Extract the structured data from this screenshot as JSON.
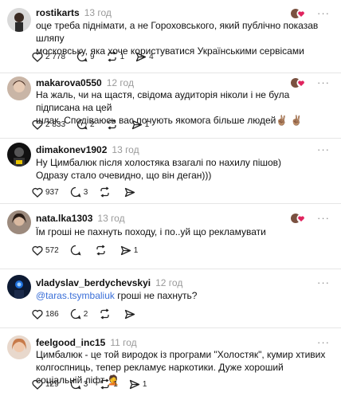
{
  "posts": [
    {
      "username": "rostikarts",
      "time": "13 год",
      "line1": "оце треба піднімати, а не Гороховського, який публічно показав шляпу",
      "line2": "московську, яка хоче користуватися Українськими сервісами",
      "likes": "2 778",
      "replies": "9",
      "reposts": "1",
      "shares": "4",
      "liked_by_author_badge": true
    },
    {
      "username": "makarova0550",
      "time": "12 год",
      "line1": "На жаль, чи на щастя, свідома аудиторія ніколи і не була підписана на цей",
      "line2": "шлак. Сподіваюсь вас почують якомога більше людей✌🏽 ✌🏽",
      "likes": "2 833",
      "replies": "2",
      "reposts": "",
      "shares": "1",
      "liked_by_author_badge": true
    },
    {
      "username": "dimakonev1902",
      "time": "13 год",
      "line1": "Ну Цимбалюк після холостяка взагалі по нахилу пішов)",
      "line2": "Одразу стало очевидно, що він деган)))",
      "likes": "937",
      "replies": "3",
      "reposts": "",
      "shares": "",
      "liked_by_author_badge": false
    },
    {
      "username": "nata.lka1303",
      "time": "13 год",
      "line1": "Їм гроші не пахнуть походу, і по..уй що рекламувати",
      "line2": "",
      "likes": "572",
      "replies": "",
      "reposts": "",
      "shares": "1",
      "liked_by_author_badge": true
    },
    {
      "username": "vladyslav_berdychevskyi",
      "time": "12 год",
      "mention": "@taras.tsymbaliuk",
      "line1": " гроші не пахнуть?",
      "line2": "",
      "likes": "186",
      "replies": "2",
      "reposts": "",
      "shares": "",
      "liked_by_author_badge": false
    },
    {
      "username": "feelgood_inc15",
      "time": "11 год",
      "line1": "Цимбалюк - це той виродок із програми \"Холостяк\", кумир хтивих",
      "line2": "колгоспниць, тепер рекламує наркотики. Дуже хороший соціальній ліфт 🤦",
      "likes": "129",
      "replies": "3",
      "reposts": "1",
      "shares": "1",
      "liked_by_author_badge": false
    }
  ],
  "more_label": "···",
  "colors": {
    "mention": "#3a6fd8",
    "heart": "#e0245e",
    "divider": "#e6e6e6"
  }
}
